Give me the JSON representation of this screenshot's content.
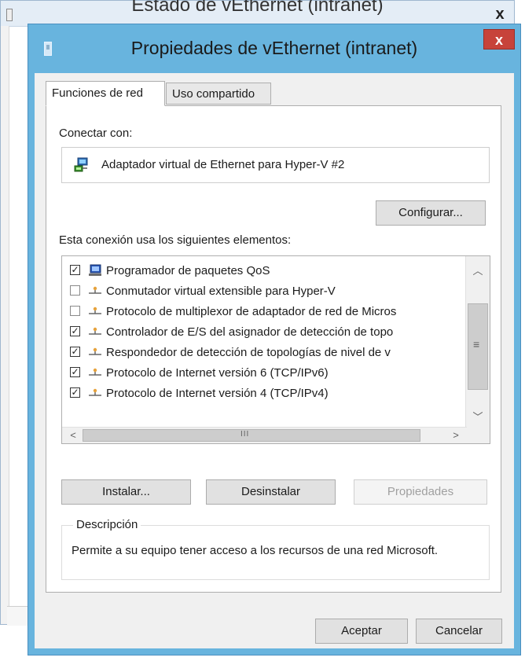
{
  "background_window": {
    "title": "Estado de vEthernet (intranet)",
    "close_glyph": "x"
  },
  "dialog": {
    "title": "Propiedades de vEthernet (intranet)",
    "close_glyph": "x"
  },
  "tabs": [
    {
      "label": "Funciones de red",
      "active": true
    },
    {
      "label": "Uso compartido",
      "active": false
    }
  ],
  "connect": {
    "label": "Conectar con:",
    "adapter": "Adaptador virtual de Ethernet para Hyper-V #2",
    "adapter_icon": "network-adapter-icon",
    "configure_button": "Configurar..."
  },
  "components": {
    "label": "Esta conexión usa los siguientes elementos:",
    "items": [
      {
        "label": "Programador de paquetes QoS",
        "checked": true,
        "icon": "qos-scheduler-icon"
      },
      {
        "label": "Conmutador virtual extensible para Hyper-V",
        "checked": false,
        "icon": "protocol-icon"
      },
      {
        "label": "Protocolo de multiplexor de adaptador de red de Micros",
        "checked": false,
        "icon": "protocol-icon"
      },
      {
        "label": "Controlador de E/S del asignador de detección de topo",
        "checked": true,
        "icon": "protocol-icon"
      },
      {
        "label": "Respondedor de detección de topologías de nivel de v",
        "checked": true,
        "icon": "protocol-icon"
      },
      {
        "label": "Protocolo de Internet versión 6 (TCP/IPv6)",
        "checked": true,
        "icon": "protocol-icon"
      },
      {
        "label": "Protocolo de Internet versión 4 (TCP/IPv4)",
        "checked": true,
        "icon": "protocol-icon"
      }
    ],
    "hscroll_grip": "III",
    "vscroll_grip": "≡"
  },
  "actions": {
    "install": "Instalar...",
    "uninstall": "Desinstalar",
    "properties": "Propiedades"
  },
  "description": {
    "legend": "Descripción",
    "text": "Permite a su equipo tener acceso a los recursos de una red Microsoft."
  },
  "footer": {
    "ok": "Aceptar",
    "cancel": "Cancelar"
  },
  "colors": {
    "title_bar": "#68b4de",
    "close_button": "#c7433a",
    "panel": "#ffffff",
    "client": "#f0f0f0"
  }
}
